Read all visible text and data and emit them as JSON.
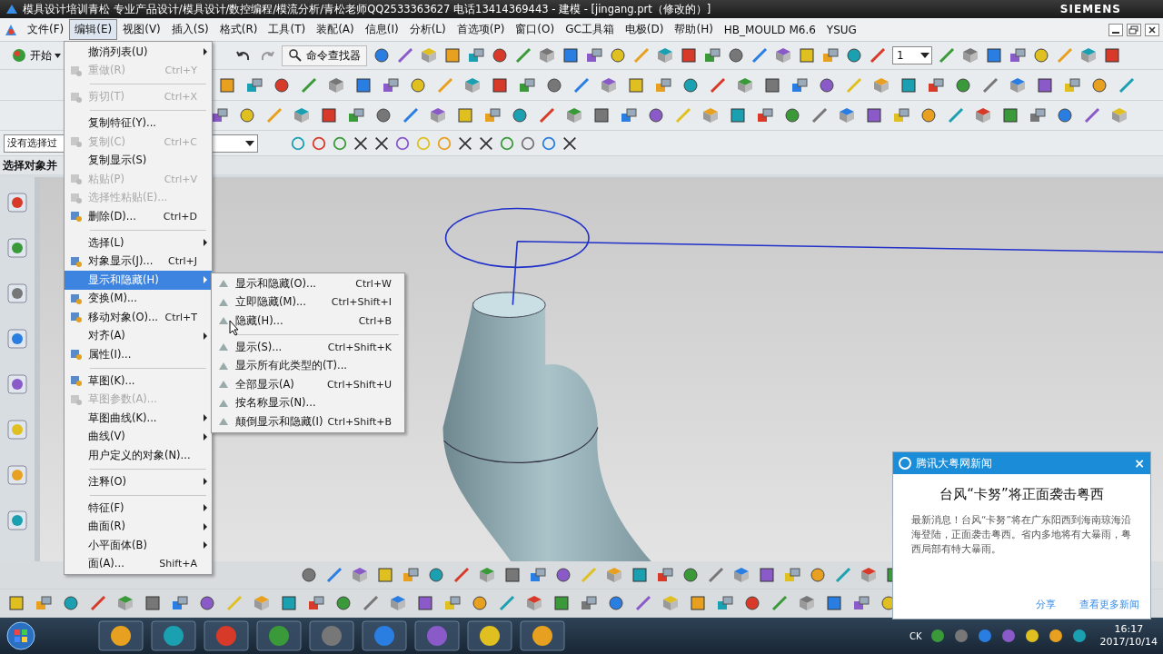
{
  "window": {
    "title": "模具设计培训青松 专业产品设计/模具设计/数控编程/模流分析/青松老师QQ2533363627 电话13414369443 - 建模 - [jingang.prt（修改的）]",
    "brand": "SIEMENS"
  },
  "menu_bar": [
    {
      "label": "文件(F)",
      "selected": false
    },
    {
      "label": "编辑(E)",
      "selected": true
    },
    {
      "label": "视图(V)",
      "selected": false
    },
    {
      "label": "插入(S)",
      "selected": false
    },
    {
      "label": "格式(R)",
      "selected": false
    },
    {
      "label": "工具(T)",
      "selected": false
    },
    {
      "label": "装配(A)",
      "selected": false
    },
    {
      "label": "信息(I)",
      "selected": false
    },
    {
      "label": "分析(L)",
      "selected": false
    },
    {
      "label": "首选项(P)",
      "selected": false
    },
    {
      "label": "窗口(O)",
      "selected": false
    },
    {
      "label": "GC工具箱",
      "selected": false
    },
    {
      "label": "电极(D)",
      "selected": false
    },
    {
      "label": "帮助(H)",
      "selected": false
    },
    {
      "label": "HB_MOULD M6.6",
      "selected": false
    },
    {
      "label": "YSUG",
      "selected": false
    }
  ],
  "toolbar": {
    "start_label": "开始",
    "command_finder": "命令查找器",
    "layer": "1"
  },
  "selection_bar": {
    "filter": "没有选择过"
  },
  "cue_line": "选择对象并",
  "edit_menu": [
    {
      "label": "撤消列表(U)",
      "disabled": false,
      "selected": false,
      "submenu": true,
      "separator_before": false,
      "icon": false
    },
    {
      "label": "重做(R)",
      "shortcut": "Ctrl+Y",
      "disabled": true,
      "selected": false,
      "submenu": false,
      "separator_before": false,
      "icon": true
    },
    {
      "label": "剪切(T)",
      "shortcut": "Ctrl+X",
      "disabled": true,
      "selected": false,
      "submenu": false,
      "separator_before": true,
      "icon": true
    },
    {
      "label": "复制特征(Y)...",
      "disabled": false,
      "selected": false,
      "submenu": false,
      "separator_before": true,
      "icon": false
    },
    {
      "label": "复制(C)",
      "shortcut": "Ctrl+C",
      "disabled": true,
      "selected": false,
      "submenu": false,
      "separator_before": false,
      "icon": true
    },
    {
      "label": "复制显示(S)",
      "disabled": false,
      "selected": false,
      "submenu": false,
      "separator_before": false,
      "icon": false
    },
    {
      "label": "粘贴(P)",
      "shortcut": "Ctrl+V",
      "disabled": true,
      "selected": false,
      "submenu": false,
      "separator_before": false,
      "icon": true
    },
    {
      "label": "选择性粘贴(E)...",
      "disabled": true,
      "selected": false,
      "submenu": false,
      "separator_before": false,
      "icon": true
    },
    {
      "label": "删除(D)...",
      "shortcut": "Ctrl+D",
      "disabled": false,
      "selected": false,
      "submenu": false,
      "separator_before": false,
      "icon": true
    },
    {
      "label": "选择(L)",
      "disabled": false,
      "selected": false,
      "submenu": true,
      "separator_before": true,
      "icon": false
    },
    {
      "label": "对象显示(J)...",
      "shortcut": "Ctrl+J",
      "disabled": false,
      "selected": false,
      "submenu": false,
      "separator_before": false,
      "icon": true
    },
    {
      "label": "显示和隐藏(H)",
      "disabled": false,
      "selected": true,
      "submenu": true,
      "separator_before": false,
      "icon": false
    },
    {
      "label": "变换(M)...",
      "disabled": false,
      "selected": false,
      "submenu": false,
      "separator_before": false,
      "icon": true
    },
    {
      "label": "移动对象(O)...",
      "shortcut": "Ctrl+T",
      "disabled": false,
      "selected": false,
      "submenu": false,
      "separator_before": false,
      "icon": true
    },
    {
      "label": "对齐(A)",
      "disabled": false,
      "selected": false,
      "submenu": true,
      "separator_before": false,
      "icon": false
    },
    {
      "label": "属性(I)...",
      "disabled": false,
      "selected": false,
      "submenu": false,
      "separator_before": false,
      "icon": true
    },
    {
      "label": "草图(K)...",
      "disabled": false,
      "selected": false,
      "submenu": false,
      "separator_before": true,
      "icon": true
    },
    {
      "label": "草图参数(A)...",
      "disabled": true,
      "selected": false,
      "submenu": false,
      "separator_before": false,
      "icon": true
    },
    {
      "label": "草图曲线(K)...",
      "disabled": false,
      "selected": false,
      "submenu": true,
      "separator_before": false,
      "icon": false
    },
    {
      "label": "曲线(V)",
      "disabled": false,
      "selected": false,
      "submenu": true,
      "separator_before": false,
      "icon": false
    },
    {
      "label": "用户定义的对象(N)...",
      "disabled": false,
      "selected": false,
      "submenu": false,
      "separator_before": false,
      "icon": false
    },
    {
      "label": "注释(O)",
      "disabled": false,
      "selected": false,
      "submenu": true,
      "separator_before": true,
      "icon": false
    },
    {
      "label": "特征(F)",
      "disabled": false,
      "selected": false,
      "submenu": true,
      "separator_before": true,
      "icon": false
    },
    {
      "label": "曲面(R)",
      "disabled": false,
      "selected": false,
      "submenu": true,
      "separator_before": false,
      "icon": false
    },
    {
      "label": "小平面体(B)",
      "disabled": false,
      "selected": false,
      "submenu": true,
      "separator_before": false,
      "icon": false
    },
    {
      "label": "面(A)...",
      "shortcut": "Shift+A",
      "disabled": false,
      "selected": false,
      "submenu": false,
      "separator_before": false,
      "icon": false
    }
  ],
  "submenu": [
    {
      "label": "显示和隐藏(O)...",
      "shortcut": "Ctrl+W",
      "separator_before": false
    },
    {
      "label": "立即隐藏(M)...",
      "shortcut": "Ctrl+Shift+I",
      "separator_before": false
    },
    {
      "label": "隐藏(H)...",
      "shortcut": "Ctrl+B",
      "separator_before": false
    },
    {
      "label": "显示(S)...",
      "shortcut": "Ctrl+Shift+K",
      "separator_before": true
    },
    {
      "label": "显示所有此类型的(T)...",
      "separator_before": false
    },
    {
      "label": "全部显示(A)",
      "shortcut": "Ctrl+Shift+U",
      "separator_before": false
    },
    {
      "label": "按名称显示(N)...",
      "separator_before": false
    },
    {
      "label": "颠倒显示和隐藏(I)",
      "shortcut": "Ctrl+Shift+B",
      "separator_before": false
    }
  ],
  "news_popup": {
    "source": "腾讯大粤网新闻",
    "close": "×",
    "headline": "台风“卡努”将正面袭击粤西",
    "body": "最新消息！台风“卡努”将在广东阳西到海南琼海沿海登陆，正面袭击粤西。省内多地将有大暴雨，粤西局部有特大暴雨。",
    "links": [
      "分享",
      "查看更多新闻"
    ]
  },
  "taskbar": {
    "input_indicator": "CK",
    "time": "16:17",
    "date": "2017/10/14"
  }
}
